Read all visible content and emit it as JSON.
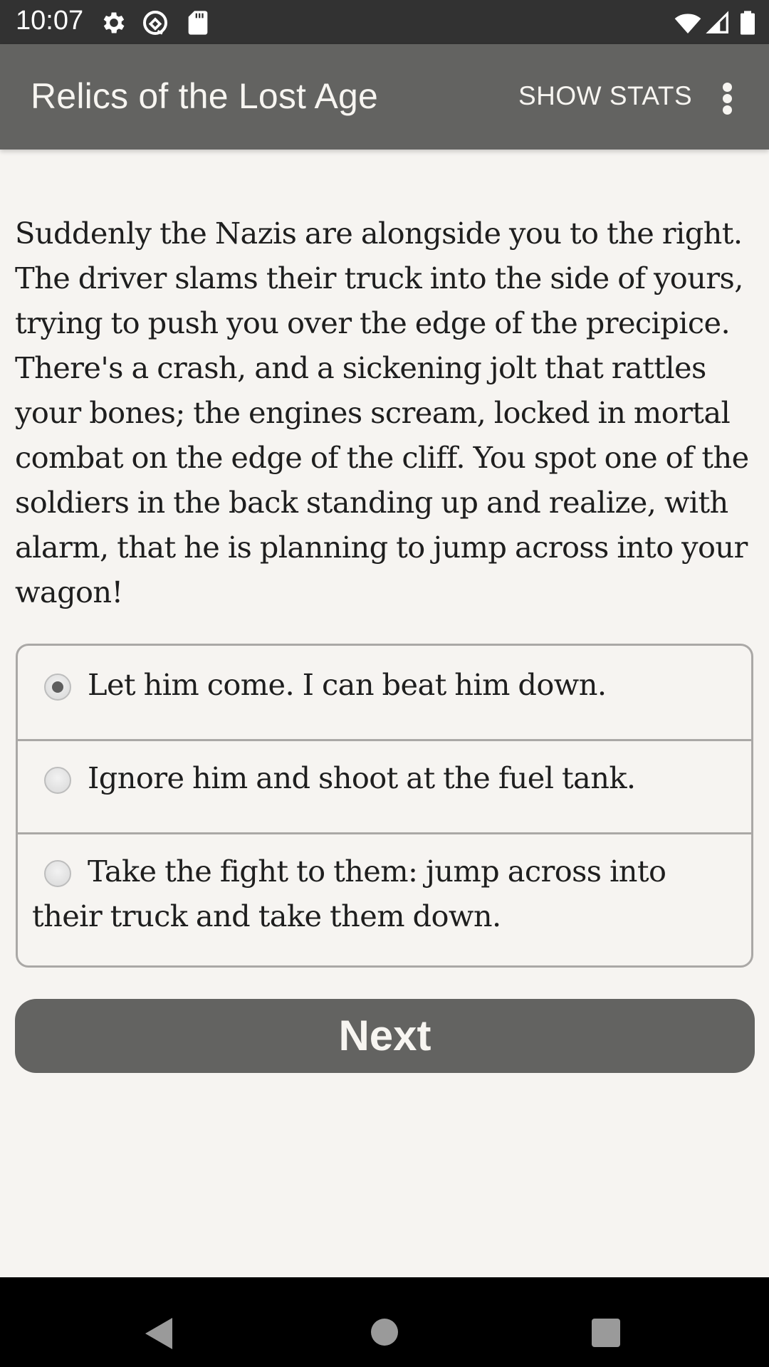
{
  "status_bar": {
    "time": "10:07",
    "left_icons": [
      "gear-icon",
      "data-saver-icon",
      "sd-card-icon"
    ],
    "right_icons": [
      "wifi-icon",
      "cellular-signal-icon",
      "battery-icon"
    ]
  },
  "app_bar": {
    "title": "Relics of the Lost Age",
    "action_label": "SHOW STATS",
    "overflow_icon": "more-vert-icon"
  },
  "story": {
    "text": "Suddenly the Nazis are alongside you to the right. The driver slams their truck into the side of yours, trying to push you over the edge of the precipice. There's a crash, and a sickening jolt that rattles your bones; the engines scream, locked in mortal combat on the edge of the cliff. You spot one of the soldiers in the back standing up and realize, with alarm, that he is planning to jump across into your wagon!"
  },
  "choices": [
    {
      "label": "Let him come. I can beat him down.",
      "selected": true
    },
    {
      "label": "Ignore him and shoot at the fuel tank.",
      "selected": false
    },
    {
      "label": "Take the fight to them: jump across into their truck and take them down.",
      "selected": false
    }
  ],
  "next_button": {
    "label": "Next"
  },
  "nav_bar": {
    "buttons": [
      "back",
      "home",
      "recents"
    ]
  },
  "colors": {
    "app_bar": "#636361",
    "status_bar": "#323232",
    "background": "#f6f4f1",
    "button": "#636361",
    "border": "#aaa8a6"
  }
}
